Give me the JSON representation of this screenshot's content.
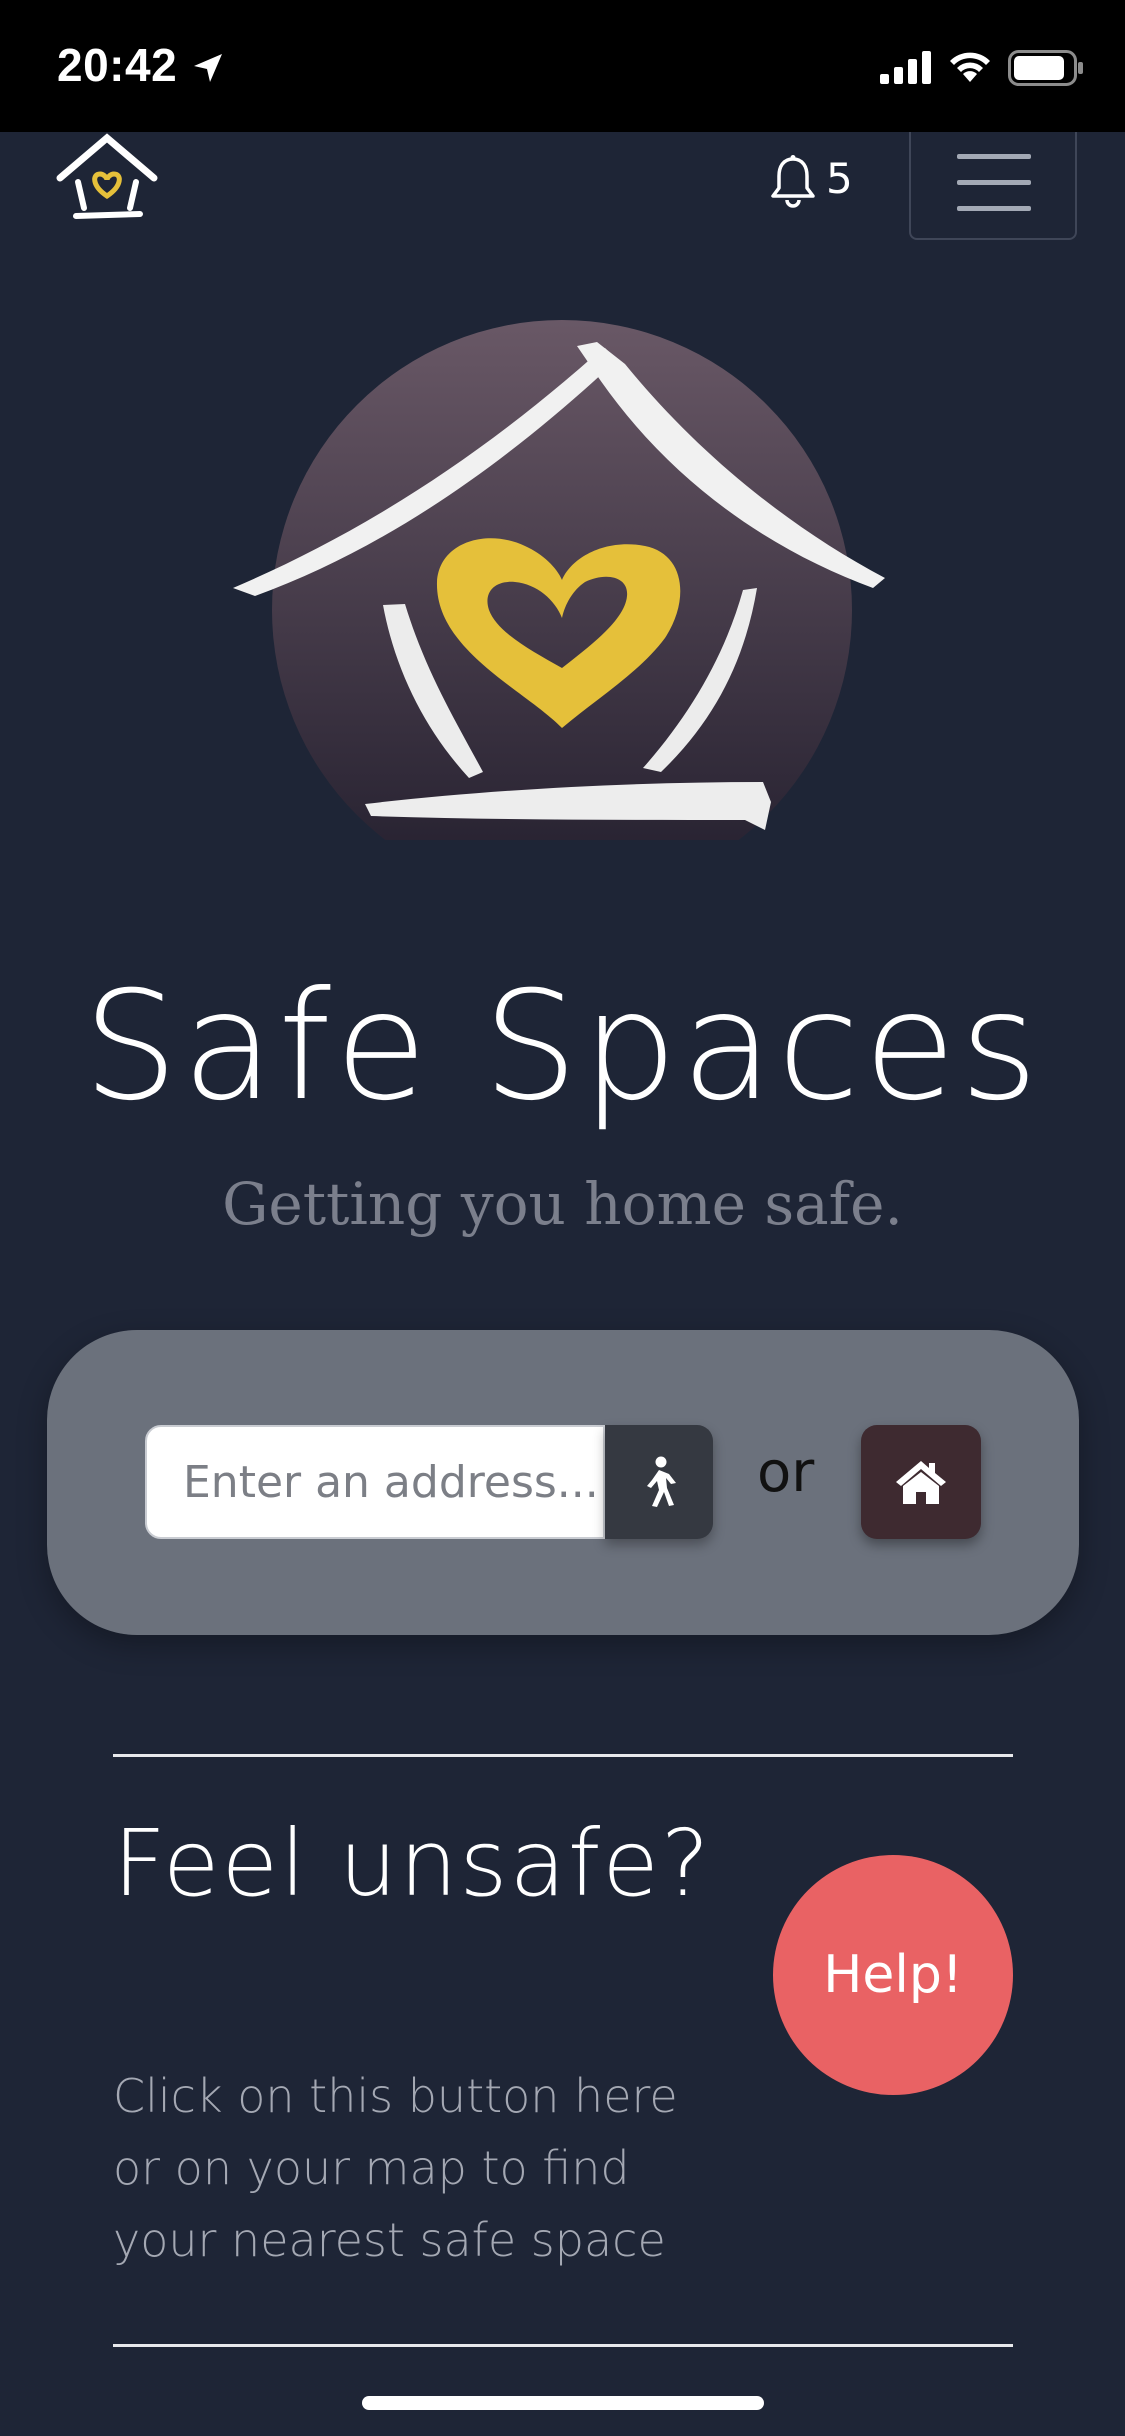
{
  "status_bar": {
    "time": "20:42",
    "icons": [
      "location-arrow-icon",
      "signal-icon",
      "wifi-icon",
      "battery-icon"
    ]
  },
  "navbar": {
    "logo_icon": "safe-spaces-logo",
    "bell_icon": "bell-icon",
    "notification_count": "5",
    "menu_icon": "hamburger-menu-icon"
  },
  "hero": {
    "logo_icon": "house-heart-logo",
    "title": "Safe Spaces",
    "tagline": "Getting you home safe."
  },
  "search": {
    "placeholder": "Enter an address...",
    "value": "",
    "walk_icon": "walking-person-icon",
    "or_text": "or",
    "home_icon": "home-icon"
  },
  "unsafe": {
    "heading": "Feel unsafe?",
    "description": "Click on this button here or on your map to find your nearest safe space",
    "help_label": "Help!"
  },
  "colors": {
    "background": "#1e2536",
    "card": "#6b717c",
    "help": "#e96264",
    "home_button": "#3e2a30",
    "heart": "#e5c03a"
  }
}
